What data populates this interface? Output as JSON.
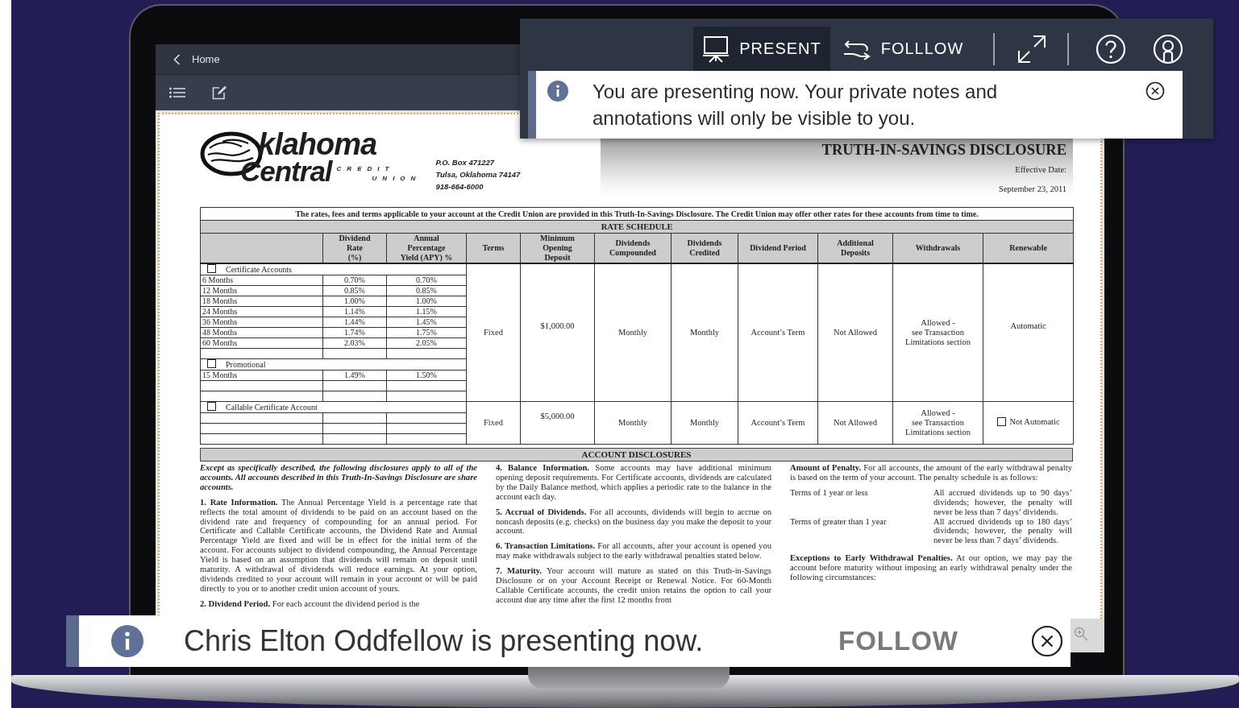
{
  "top_bar": {
    "back_label": "Home"
  },
  "presenter_controls": {
    "buttons": [
      {
        "kind": "present",
        "label": "PRESENT",
        "selected": true
      },
      {
        "kind": "follow",
        "label": "FOLLLOW",
        "selected": false
      }
    ]
  },
  "present_notice": {
    "text": "You are presenting now. Your private notes and annotations will only be visible to you."
  },
  "document": {
    "logo": {
      "line1": "klahoma",
      "line2": "Central",
      "tag1": "CREDIT",
      "tag2": "UNION"
    },
    "address": [
      "P.O. Box 471227",
      "Tulsa, Oklahoma 74147",
      "918-664-6000"
    ],
    "title": "TRUTH-IN-SAVINGS DISCLOSURE",
    "effective_label": "Effective Date:",
    "effective_date": "September 23, 2011",
    "rate_table": {
      "intro": "The rates, fees and terms applicable to your account at the Credit Union are provided in this Truth-In-Savings Disclosure.  The Credit Union may offer other rates for these accounts from time to time.",
      "heading": "RATE SCHEDULE",
      "columns": [
        "Dividend\nRate\n(%)",
        "Annual\nPercentage\nYield (APY) %",
        "Terms",
        "Minimum\nOpening\nDeposit",
        "Dividends\nCompounded",
        "Dividends\nCredited",
        "Dividend Period",
        "Additional\nDeposits",
        "Withdrawals",
        "Renewable"
      ],
      "groups": [
        {
          "rows": [
            {
              "kind": "section",
              "label": "Certificate Accounts",
              "checked": false
            },
            {
              "kind": "rate",
              "term": "6 Months",
              "rate": "0.70%",
              "apy": "0.70%"
            },
            {
              "kind": "rate",
              "term": "12 Months",
              "rate": "0.85%",
              "apy": "0.85%"
            },
            {
              "kind": "rate",
              "term": "18 Months",
              "rate": "1.00%",
              "apy": "1.00%"
            },
            {
              "kind": "rate",
              "term": "24 Months",
              "rate": "1.14%",
              "apy": "1.15%"
            },
            {
              "kind": "rate",
              "term": "36 Months",
              "rate": "1.44%",
              "apy": "1.45%"
            },
            {
              "kind": "rate",
              "term": "48 Months",
              "rate": "1.74%",
              "apy": "1.75%"
            },
            {
              "kind": "rate",
              "term": "60 Months",
              "rate": "2.03%",
              "apy": "2.05%"
            },
            {
              "kind": "blank"
            },
            {
              "kind": "section",
              "label": "Promotional",
              "checked": false
            },
            {
              "kind": "rate",
              "term": "15 Months",
              "rate": "1.49%",
              "apy": "1.50%"
            },
            {
              "kind": "blank"
            },
            {
              "kind": "blank"
            }
          ],
          "terms": "Fixed",
          "min_deposit": "$1,000.00",
          "compounded": "Monthly",
          "credited": "Monthly",
          "period": "Account’s Term",
          "additional": "Not Allowed",
          "withdrawals": "Allowed -\nsee Transaction\nLimitations section",
          "renewable": {
            "label": "Automatic"
          }
        },
        {
          "rows": [
            {
              "kind": "section",
              "label": "Callable Certificate Account",
              "checked": false
            },
            {
              "kind": "blank"
            },
            {
              "kind": "blank"
            },
            {
              "kind": "blank"
            }
          ],
          "terms": "Fixed",
          "min_deposit": "$5,000.00",
          "compounded": "Monthly",
          "credited": "Monthly",
          "period": "Account’s Term",
          "additional": "Not Allowed",
          "withdrawals": "Allowed -\nsee Transaction\nLimitations section",
          "renewable": {
            "label": "Not Automatic",
            "checked": false
          }
        }
      ]
    },
    "disclosures": {
      "heading": "ACCOUNT DISCLOSURES",
      "columns": [
        [
          {
            "kind": "lead",
            "text": "Except as specifically described, the following disclosures apply to all of the accounts. All accounts described in this Truth-In-Savings Disclosure are share accounts."
          },
          {
            "kind": "text",
            "text": "**1.  Rate Information.** The Annual Percentage Yield is a percentage rate that reflects the total amount of dividends to be paid on an account based on the dividend rate and frequency of compounding for an annual period. For Certificate and Callable Certificate accounts, the Dividend Rate and Annual Percentage Yield are fixed and will be in effect for the initial term of the account. For accounts subject to dividend compounding, the Annual Percentage Yield is based on an assumption that dividends will remain on deposit until maturity. A withdrawal of dividends will reduce earnings. At your option, dividends credited to your account will remain in your account or will be paid directly to you or to another credit union account of yours."
          },
          {
            "kind": "text",
            "text": "**2.  Dividend Period.** For each account the dividend period is the"
          }
        ],
        [
          {
            "kind": "text",
            "text": "**4.  Balance Information.** Some accounts may have additional minimum opening deposit requirements. For Certificate accounts, dividends are calculated by the Daily Balance method, which applies a periodic rate to the balance in the account each day."
          },
          {
            "kind": "text",
            "text": "**5.  Accrual of Dividends.** For all accounts, dividends will begin to accrue on noncash deposits (e.g. checks) on the business day you make the deposit to your account."
          },
          {
            "kind": "text",
            "text": "**6.  Transaction Limitations.** For all accounts, after your account is opened you may make withdrawals subject to the early withdrawal penalties stated below."
          },
          {
            "kind": "text",
            "text": "**7.  Maturity.** Your account will mature as stated on this Truth-in-Savings Disclosure or on your Account Receipt or Renewal Notice. For 60-Month Callable Certificate accounts, the credit union retains the option to call your account due any time after the first 12 months from"
          }
        ],
        [
          {
            "kind": "text",
            "text": "**Amount of Penalty.** For all accounts, the amount of the early withdrawal penalty is based on the term of your account. The penalty schedule is as follows:"
          },
          {
            "kind": "schedule",
            "items": [
              {
                "term": "Terms of 1 year or less",
                "penalty": "All accrued dividends up to 90 days’ dividends; however, the penalty will never be less than 7 days’ dividends."
              },
              {
                "term": "Terms of greater than 1 year",
                "penalty": "All accrued dividends up to 180 days’ dividends; however, the penalty will never be less than 7 days’ dividends."
              }
            ]
          },
          {
            "kind": "text",
            "text": "**Exceptions to Early Withdrawal Penalties.** At our option, we may pay the account before maturity without imposing an early withdrawal penalty under the following circumstances:"
          }
        ]
      ]
    }
  },
  "presenter_banner": {
    "text": "Chris Elton Oddfellow is presenting now.",
    "action": "FOLLOW"
  }
}
